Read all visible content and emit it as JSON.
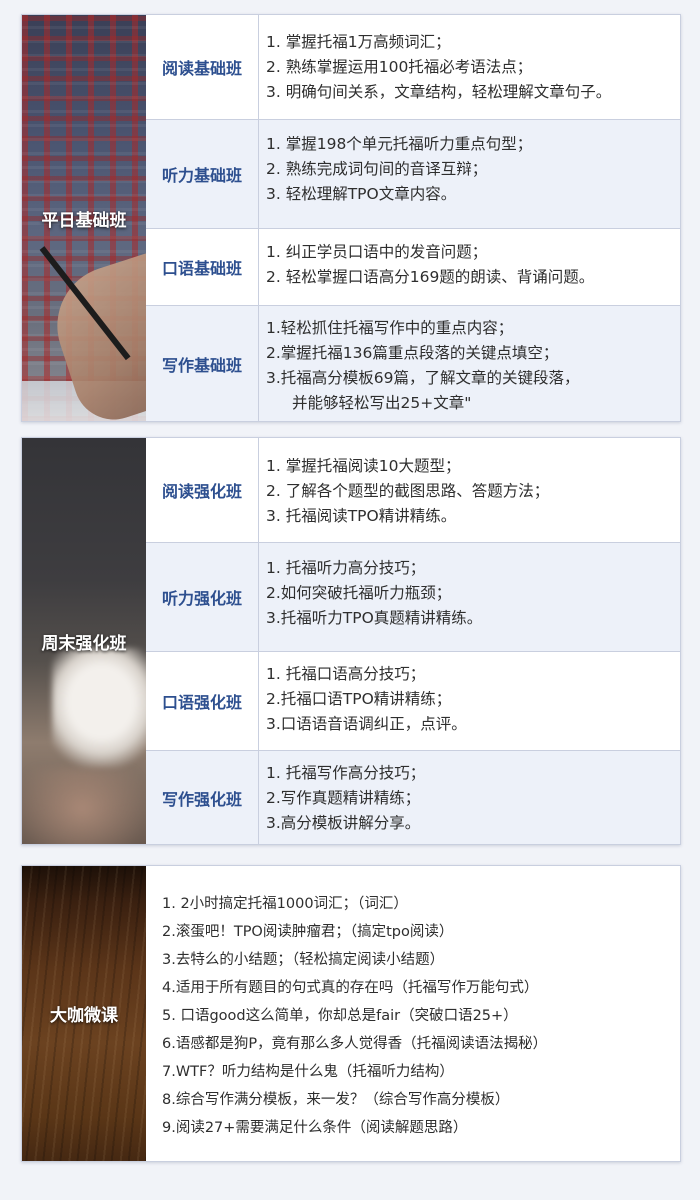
{
  "sections": [
    {
      "title": "平日基础班",
      "rows": [
        {
          "label": "阅读基础班",
          "items": [
            "1. 掌握托福1万高频词汇；",
            "2. 熟练掌握运用100托福必考语法点；",
            "3. 明确句间关系，文章结构，轻松理解文章句子。"
          ]
        },
        {
          "label": "听力基础班",
          "items": [
            "1. 掌握198个单元托福听力重点句型；",
            "2. 熟练完成词句间的音译互辩；",
            "3. 轻松理解TPO文章内容。"
          ]
        },
        {
          "label": "口语基础班",
          "items": [
            "1. 纠正学员口语中的发音问题；",
            "2. 轻松掌握口语高分169题的朗读、背诵问题。"
          ]
        },
        {
          "label": "写作基础班",
          "items": [
            "1.轻松抓住托福写作中的重点内容；",
            "2.掌握托福136篇重点段落的关键点填空；",
            "3.托福高分模板69篇，了解文章的关键段落，",
            "并能够轻松写出25+文章\""
          ]
        }
      ]
    },
    {
      "title": "周末强化班",
      "rows": [
        {
          "label": "阅读强化班",
          "items": [
            "1.  掌握托福阅读10大题型；",
            "2. 了解各个题型的截图思路、答题方法；",
            "3. 托福阅读TPO精讲精练。"
          ]
        },
        {
          "label": "听力强化班",
          "items": [
            "1. 托福听力高分技巧；",
            "2.如何突破托福听力瓶颈；",
            "3.托福听力TPO真题精讲精练。"
          ]
        },
        {
          "label": "口语强化班",
          "items": [
            "1. 托福口语高分技巧；",
            "2.托福口语TPO精讲精练；",
            "3.口语语音语调纠正，点评。"
          ]
        },
        {
          "label": "写作强化班",
          "items": [
            "1. 托福写作高分技巧；",
            "2.写作真题精讲精练；",
            "3.高分模板讲解分享。"
          ]
        }
      ]
    },
    {
      "title": "大咖微课",
      "lessons": [
        "1. 2小时搞定托福1000词汇；（词汇）",
        "2.滚蛋吧！TPO阅读肿瘤君；（搞定tpo阅读）",
        "3.去特么的小结题；（轻松搞定阅读小结题）",
        "4.适用于所有题目的句式真的存在吗（托福写作万能句式）",
        "5. 口语good这么简单，你却总是fair（突破口语25+）",
        "6.语感都是狗P，竟有那么多人觉得香（托福阅读语法揭秘）",
        "7.WTF？听力结构是什么鬼（托福听力结构）",
        "8.综合写作满分模板，来一发？（综合写作高分模板）",
        "9.阅读27+需要满足什么条件（阅读解题思路）"
      ]
    }
  ]
}
